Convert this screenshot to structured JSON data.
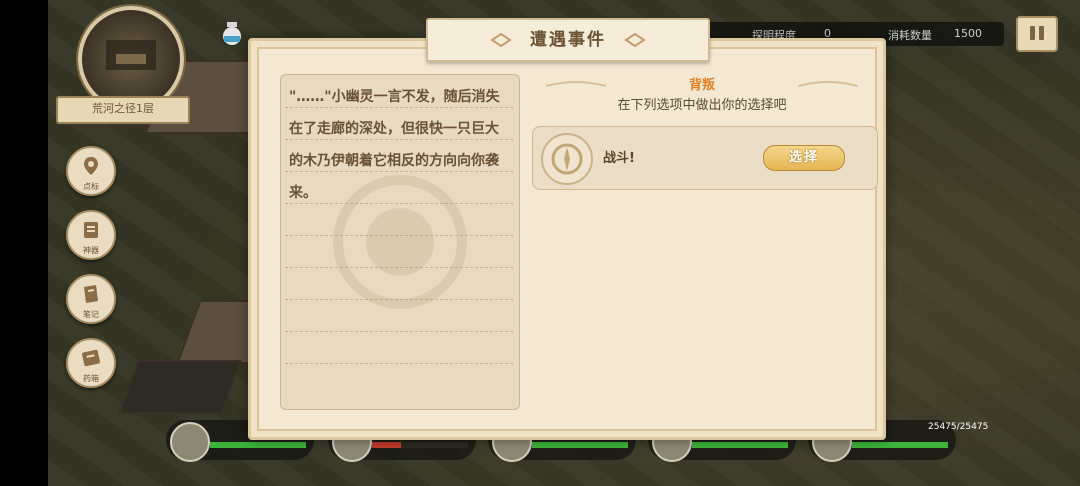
{
  "minimap": {
    "floor_label": "荒河之径1层"
  },
  "side_menu": [
    {
      "label": "点标",
      "icon": "map-pin-icon"
    },
    {
      "label": "神器",
      "icon": "scroll-icon"
    },
    {
      "label": "笔记",
      "icon": "note-icon"
    },
    {
      "label": "药箱",
      "icon": "book-icon"
    }
  ],
  "top_bar": {
    "resource1_label": "探明程度",
    "resource1_value": "0",
    "resource2_label": "消耗数量",
    "resource2_value": "1500"
  },
  "party": {
    "hp_text": "25475/25475"
  },
  "dialog": {
    "title": "遭遇事件",
    "story": "\"……\"小幽灵一言不发，随后消失在了走廊的深处，但很快一只巨大的木乃伊朝着它相反的方向向你袭来。",
    "scene_name": "背叛",
    "prompt": "在下列选项中做出你的选择吧",
    "choices": [
      {
        "label": "战斗!",
        "button": "选择"
      }
    ]
  },
  "colors": {
    "accent": "#e08022",
    "parchment": "#f3e8d2",
    "button": "#e6b653"
  }
}
